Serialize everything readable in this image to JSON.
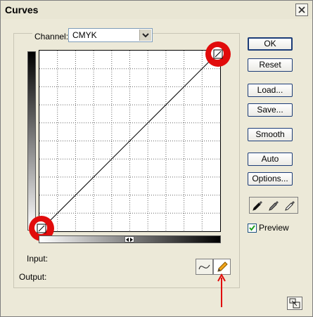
{
  "window": {
    "title": "Curves"
  },
  "channel": {
    "label": "Channel:",
    "value": "CMYK"
  },
  "labels": {
    "input": "Input:",
    "output": "Output:"
  },
  "buttons": {
    "ok": "OK",
    "reset": "Reset",
    "load": "Load...",
    "save": "Save...",
    "smooth": "Smooth",
    "auto": "Auto",
    "options": "Options..."
  },
  "preview": {
    "label": "Preview",
    "checked": true
  },
  "icons": {
    "close": "close-icon",
    "dropdown": "chevron-down-icon",
    "curve_tool": "curve-tool-icon",
    "pencil_tool": "pencil-icon",
    "eyedroppers": [
      "black-eyedropper-icon",
      "gray-eyedropper-icon",
      "white-eyedropper-icon"
    ],
    "resize": "expand-icon"
  },
  "colors": {
    "annotation": "#e10b0b",
    "accent": "#1c3c77"
  }
}
